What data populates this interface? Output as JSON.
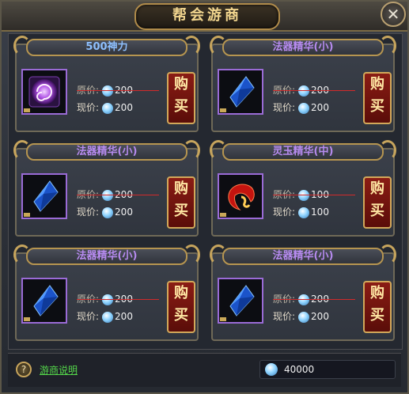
{
  "window": {
    "title": "帮会游商"
  },
  "items": [
    {
      "name": "500神力",
      "name_color": "blue",
      "icon": "purple-orb-icon",
      "orig_label": "原价:",
      "orig_price": "200",
      "cur_label": "现价:",
      "cur_price": "200",
      "buy_label_1": "购",
      "buy_label_2": "买"
    },
    {
      "name": "法器精华(小)",
      "name_color": "purple",
      "icon": "blue-crystal-icon",
      "orig_label": "原价:",
      "orig_price": "200",
      "cur_label": "现价:",
      "cur_price": "200",
      "buy_label_1": "购",
      "buy_label_2": "买"
    },
    {
      "name": "法器精华(小)",
      "name_color": "purple",
      "icon": "blue-crystal-icon",
      "orig_label": "原价:",
      "orig_price": "200",
      "cur_label": "现价:",
      "cur_price": "200",
      "buy_label_1": "购",
      "buy_label_2": "买"
    },
    {
      "name": "灵玉精华(中)",
      "name_color": "purple",
      "icon": "red-jade-icon",
      "orig_label": "原价:",
      "orig_price": "100",
      "cur_label": "现价:",
      "cur_price": "100",
      "buy_label_1": "购",
      "buy_label_2": "买"
    },
    {
      "name": "法器精华(小)",
      "name_color": "purple",
      "icon": "blue-crystal-icon",
      "orig_label": "原价:",
      "orig_price": "200",
      "cur_label": "现价:",
      "cur_price": "200",
      "buy_label_1": "购",
      "buy_label_2": "买"
    },
    {
      "name": "法器精华(小)",
      "name_color": "purple",
      "icon": "blue-crystal-icon",
      "orig_label": "原价:",
      "orig_price": "200",
      "cur_label": "现价:",
      "cur_price": "200",
      "buy_label_1": "购",
      "buy_label_2": "买"
    }
  ],
  "footer": {
    "help_icon": "?",
    "help_link": "游商说明",
    "balance": "40000"
  },
  "colors": {
    "accent_gold": "#c7a55d",
    "buy_red": "#8a1c14",
    "name_purple": "#b78bf0",
    "name_blue": "#8ec0ff",
    "help_green": "#54d84a"
  }
}
